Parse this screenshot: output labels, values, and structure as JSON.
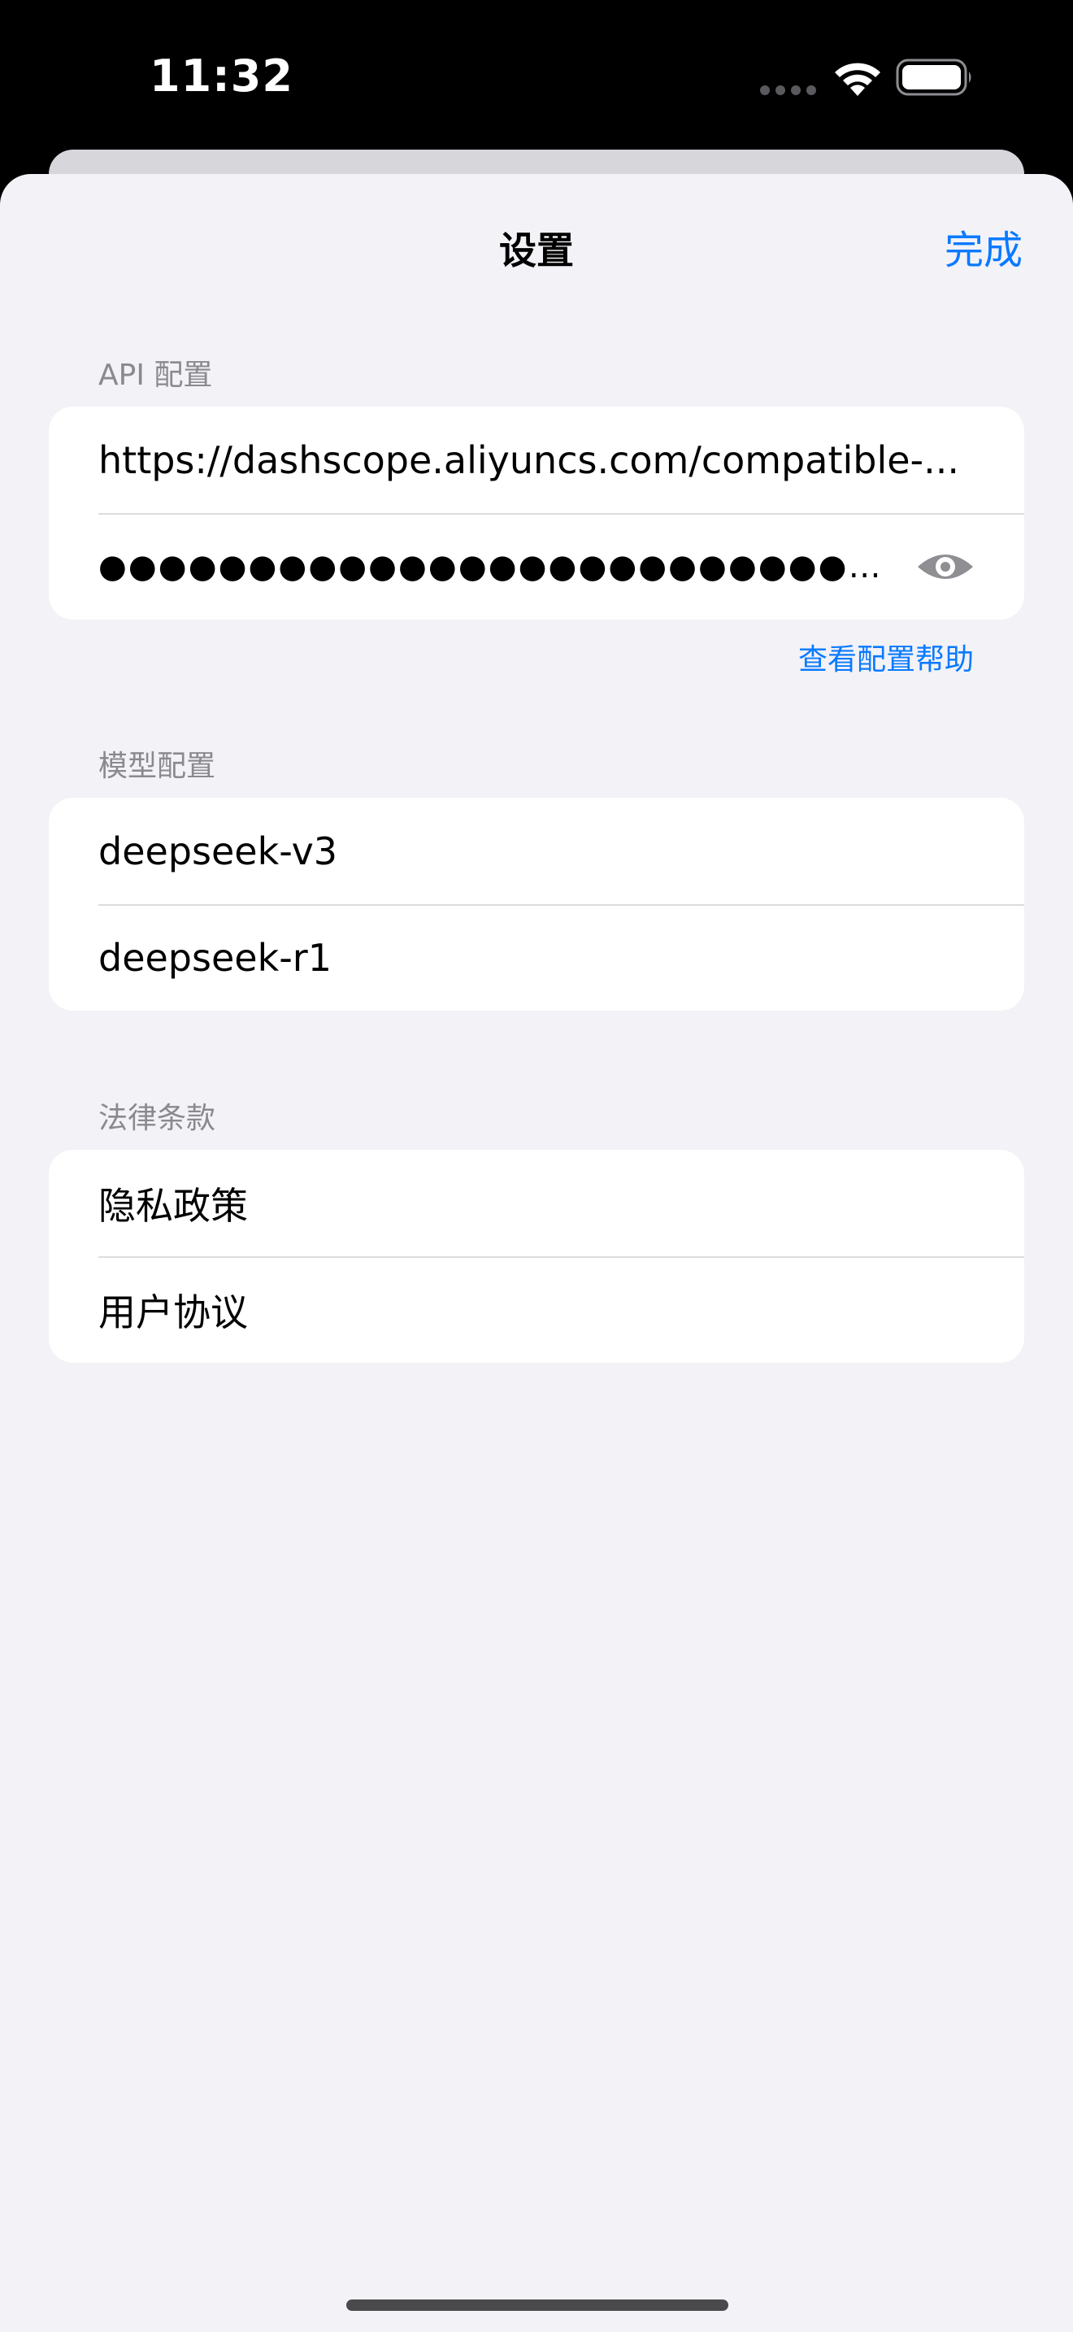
{
  "status_bar": {
    "time": "11:32",
    "icons": [
      "cellular-icon",
      "wifi-icon",
      "battery-icon"
    ]
  },
  "nav": {
    "title": "设置",
    "done_label": "完成"
  },
  "api_section": {
    "header": "API 配置",
    "base_url": "https://dashscope.aliyuncs.com/compatible-...",
    "api_key_masked": "●●●●●●●●●●●●●●●●●●●●●●●●●●●●●●●●●●●...",
    "reveal_icon": "eye-icon",
    "help_link": "查看配置帮助"
  },
  "model_section": {
    "header": "模型配置",
    "models": [
      "deepseek-v3",
      "deepseek-r1"
    ]
  },
  "legal_section": {
    "header": "法律条款",
    "items": [
      "隐私政策",
      "用户协议"
    ]
  },
  "colors": {
    "accent": "#0a7aff",
    "background": "#f2f2f7",
    "card": "#ffffff",
    "secondary_text": "#8a8a8e"
  }
}
